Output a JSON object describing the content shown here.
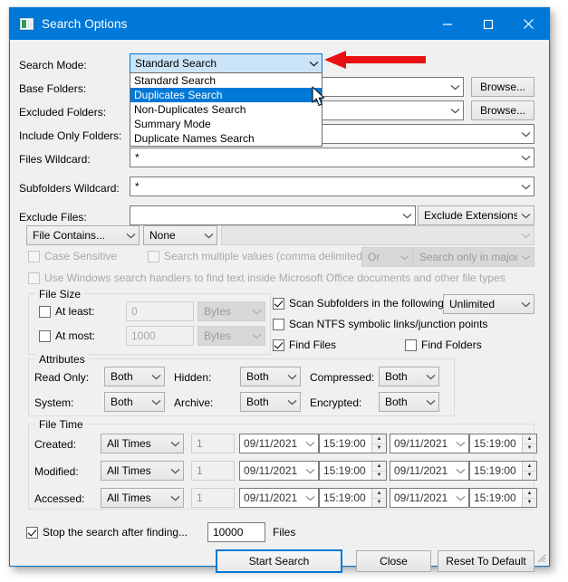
{
  "window": {
    "title": "Search Options",
    "icon": "app-icon",
    "minimize": "minimize-icon",
    "maximize": "maximize-icon",
    "close": "close-icon",
    "accent": "#0078d7"
  },
  "fields": {
    "search_mode_label": "Search Mode:",
    "search_mode_value": "Standard Search",
    "base_folders_label": "Base Folders:",
    "base_folders_value": "",
    "excluded_folders_label": "Excluded Folders:",
    "excluded_folders_value": "",
    "include_only_folders_label": "Include Only Folders:",
    "include_only_folders_value": "",
    "files_wildcard_label": "Files Wildcard:",
    "files_wildcard_value": "*",
    "subfolders_wildcard_label": "Subfolders Wildcard:",
    "subfolders_wildcard_value": "*",
    "exclude_files_label": "Exclude Files:",
    "exclude_files_value": "",
    "browse_1": "Browse...",
    "browse_2": "Browse...",
    "exclude_extensions_list": "Exclude Extensions List"
  },
  "search_mode_options": [
    "Standard Search",
    "Duplicates Search",
    "Non-Duplicates Search",
    "Summary Mode",
    "Duplicate Names Search"
  ],
  "search_mode_selected_index": 1,
  "contains": {
    "mode": "File Contains...",
    "operator": "None",
    "text": "",
    "case_sensitive": "Case Sensitive",
    "multiple_values": "Search multiple values (comma delimited)",
    "logic": "Or",
    "stream": "Search only in major stre",
    "windows_handlers": "Use Windows search handlers to find text inside Microsoft Office documents and other file types"
  },
  "file_size": {
    "title": "File Size",
    "at_least_label": "At least:",
    "at_least_value": "0",
    "at_least_unit": "Bytes",
    "at_most_label": "At most:",
    "at_most_value": "1000",
    "at_most_unit": "Bytes"
  },
  "scan": {
    "subfolders_label": "Scan Subfolders in the following depth:",
    "subfolders_checked": true,
    "depth_value": "Unlimited",
    "ntfs_label": "Scan NTFS symbolic links/junction points",
    "ntfs_checked": false,
    "find_files_label": "Find Files",
    "find_files_checked": true,
    "find_folders_label": "Find Folders",
    "find_folders_checked": false
  },
  "attributes": {
    "title": "Attributes",
    "rows": [
      {
        "label": "Read Only:",
        "value": "Both"
      },
      {
        "label": "Hidden:",
        "value": "Both"
      },
      {
        "label": "Compressed:",
        "value": "Both"
      },
      {
        "label": "System:",
        "value": "Both"
      },
      {
        "label": "Archive:",
        "value": "Both"
      },
      {
        "label": "Encrypted:",
        "value": "Both"
      }
    ]
  },
  "file_time": {
    "title": "File Time",
    "rows": [
      {
        "label": "Created:",
        "mode": "All Times",
        "count": "1",
        "date_from": "09/11/2021",
        "time_from": "15:19:00",
        "date_to": "09/11/2021",
        "time_to": "15:19:00"
      },
      {
        "label": "Modified:",
        "mode": "All Times",
        "count": "1",
        "date_from": "09/11/2021",
        "time_from": "15:19:00",
        "date_to": "09/11/2021",
        "time_to": "15:19:00"
      },
      {
        "label": "Accessed:",
        "mode": "All Times",
        "count": "1",
        "date_from": "09/11/2021",
        "time_from": "15:19:00",
        "date_to": "09/11/2021",
        "time_to": "15:19:00"
      }
    ]
  },
  "footer": {
    "stop_label": "Stop the search after finding...",
    "stop_checked": true,
    "stop_value": "10000",
    "files_label": "Files",
    "start_search": "Start Search",
    "close": "Close",
    "reset": "Reset To Default"
  },
  "annotation": {
    "arrow_color": "#e81010",
    "arrow_name": "red-callout-arrow"
  }
}
